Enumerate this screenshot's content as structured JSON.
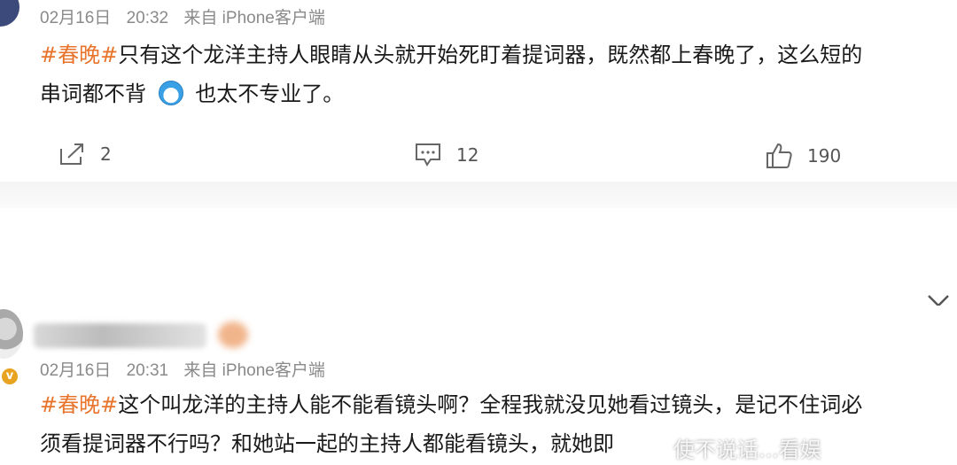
{
  "post1": {
    "date": "02月16日",
    "time": "20:32",
    "source": "来自 iPhone客户端",
    "tag": "#春晚#",
    "text_line1": "只有这个龙洋主持人眼睛从头就开始死盯着提词器，既然都上春晚了，这么短的",
    "text_line2a": "串词都不背",
    "emoji": "doge-emoji",
    "text_line2b": "也太不专业了。",
    "repost_count": "2",
    "comment_count": "12",
    "like_count": "190"
  },
  "post2": {
    "date": "02月16日",
    "time": "20:31",
    "source": "来自 iPhone客户端",
    "tag": "#春晚#",
    "text_line1": "这个叫龙洋的主持人能不能看镜头啊？全程我就没见她看过镜头，是记不住词必",
    "text_line2": "须看提词器不行吗？和她站一起的主持人都能看镜头，就她即",
    "vip_badge": "v"
  },
  "watermark": "使不说话...看娱"
}
